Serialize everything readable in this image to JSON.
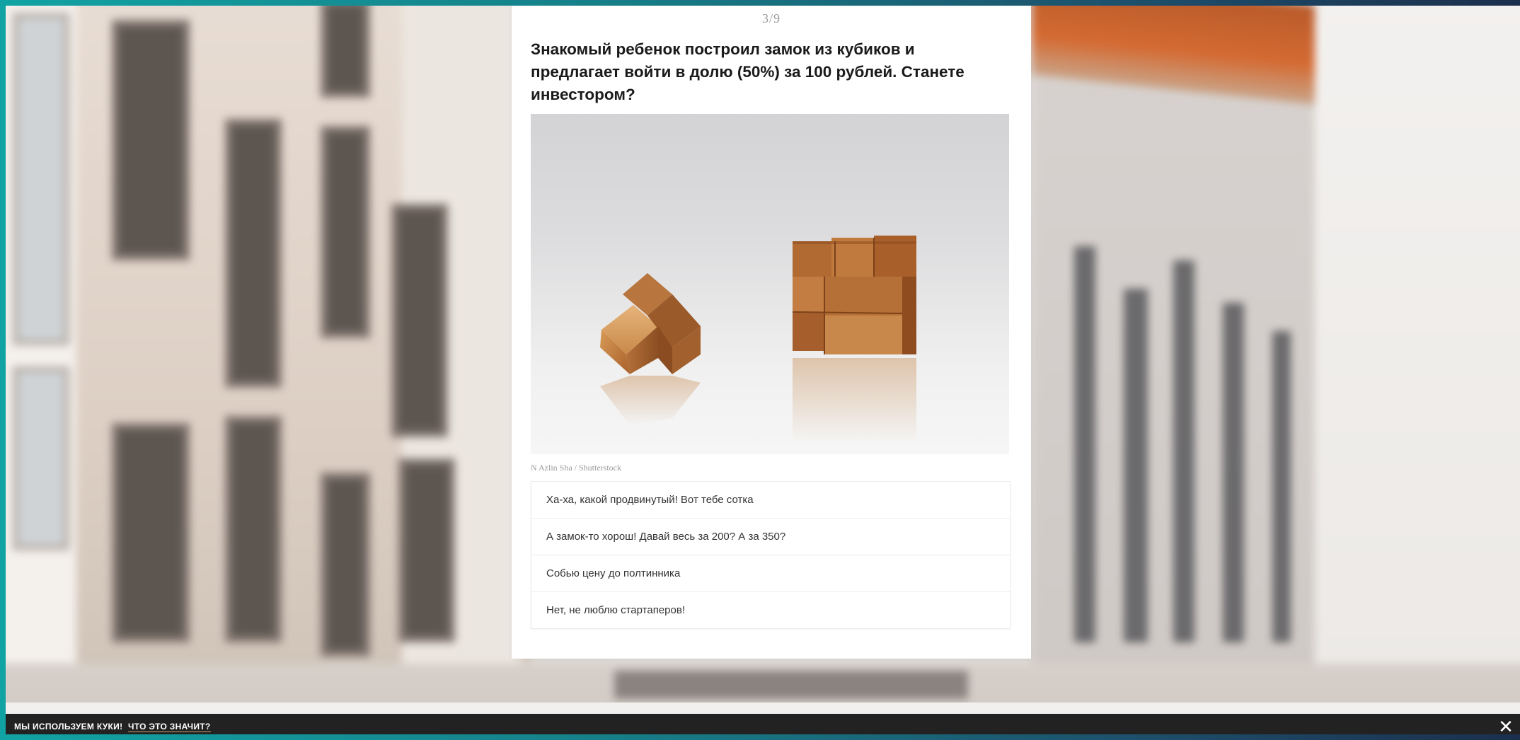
{
  "quiz": {
    "counter": "3/9",
    "question": "Знакомый ребенок построил замок из кубиков и предлагает войти в долю (50%) за 100 рублей. Станете инвестором?",
    "image_credit": "N Azlin Sha / Shutterstock",
    "answers": [
      "Ха-ха, какой продвинутый! Вот тебе сотка",
      "А замок-то хорош! Давай весь за 200? А за 350?",
      "Собью цену до полтинника",
      "Нет, не люблю стартаперов!"
    ]
  },
  "cookie": {
    "text": "Мы используем куки!",
    "link": "Что это значит?",
    "close_icon": "close-icon"
  },
  "colors": {
    "frame_teal": "#11a3a3",
    "cookie_bar": "#222222",
    "card": "#ffffff",
    "link_underline": "#c8a16a"
  }
}
